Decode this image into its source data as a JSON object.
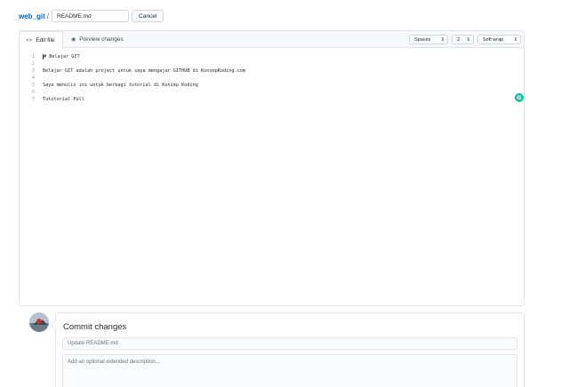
{
  "breadcrumb": {
    "repo": "web_git",
    "separator": "/",
    "filename": "README.md",
    "cancel_label": "Cancel"
  },
  "editor": {
    "tabs": [
      {
        "label": "Edit file",
        "icon": "code-icon",
        "active": true
      },
      {
        "label": "Preview changes",
        "icon": "eye-icon",
        "active": false
      }
    ],
    "indent_mode": "Spaces",
    "indent_size": "2",
    "wrap_mode": "Soft wrap",
    "lines": [
      {
        "n": "1",
        "text": "# Belajar GIT"
      },
      {
        "n": "2",
        "text": ""
      },
      {
        "n": "3",
        "text": "Belajar GIT adalah project untuk saya mengajar GITHUB di KonsepKoding.com"
      },
      {
        "n": "4",
        "text": ""
      },
      {
        "n": "5",
        "text": "Saya menulis ini untuk berbagi tutorial di Konsep Koding"
      },
      {
        "n": "6",
        "text": ""
      },
      {
        "n": "7",
        "text": "Tutotorial Pull"
      }
    ]
  },
  "commit": {
    "title": "Commit changes",
    "summary_placeholder": "Update README.md",
    "description_placeholder": "Add an optional extended description..."
  },
  "colors": {
    "link": "#0366d6",
    "grammarly": "#15c39a",
    "border": "#e1e4e8"
  }
}
